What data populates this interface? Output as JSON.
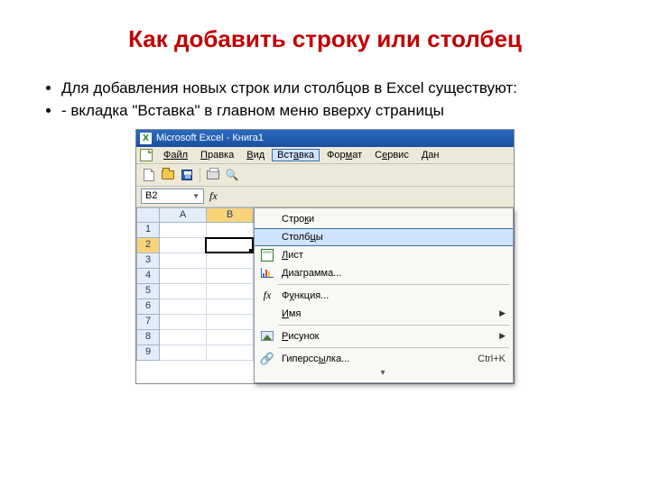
{
  "slide": {
    "title": "Как добавить строку или столбец",
    "bullets": [
      "Для добавления новых строк или столбцов в Excel существуют:",
      "- вкладка \"Вставка\" в главном меню вверху страницы"
    ]
  },
  "window": {
    "app_icon": "X",
    "title": "Microsoft Excel - Книга1"
  },
  "menubar": {
    "file": "Файл",
    "edit": "Правка",
    "view": "Вид",
    "insert": "Вставка",
    "format": "Формат",
    "tools": "Сервис",
    "data": "Дан"
  },
  "namebox": {
    "value": "B2",
    "fx": "fx"
  },
  "grid": {
    "cols": [
      "A",
      "B"
    ],
    "rows": [
      "1",
      "2",
      "3",
      "4",
      "5",
      "6",
      "7",
      "8",
      "9"
    ],
    "active": "B2"
  },
  "menu_insert": {
    "rows": "Строки",
    "cols": "Столбцы",
    "sheet": "Лист",
    "chart": "Диаграмма...",
    "func": "Функция...",
    "name": "Имя",
    "picture": "Рисунок",
    "hyperlink": "Гиперссылка...",
    "hyperlink_shortcut": "Ctrl+K",
    "fx": "fx",
    "expand": "▾"
  }
}
